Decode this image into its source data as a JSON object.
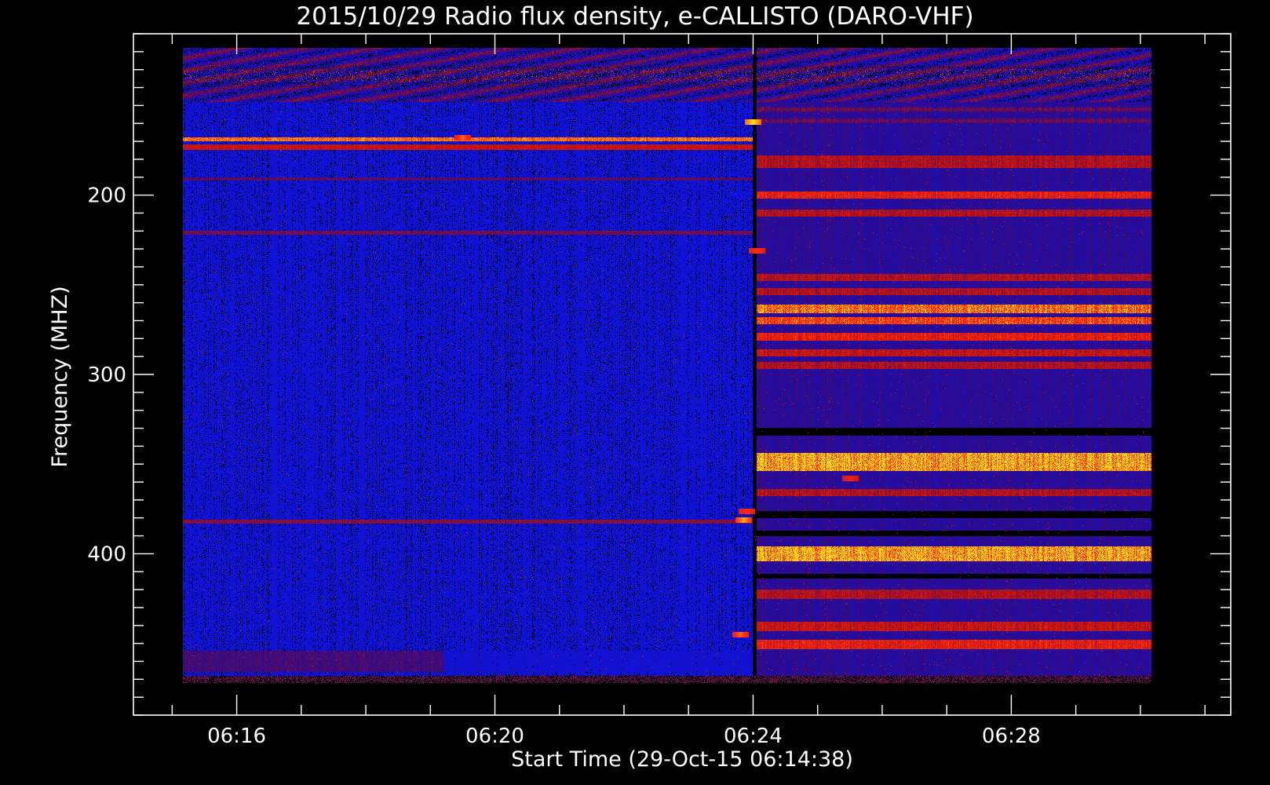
{
  "chart_data": {
    "type": "heatmap",
    "title": "2015/10/29  Radio flux density, e-CALLISTO (DARO-VHF)",
    "xlabel": "Start Time (29-Oct-15 06:14:38)",
    "ylabel": "Frequency (MHZ)",
    "x_axis": {
      "unit": "minutes after 06:00 UT",
      "range": [
        14.4,
        31.4
      ],
      "data_range": [
        15.17,
        30.17
      ],
      "major_ticks": [
        16,
        20,
        24,
        28
      ],
      "tick_labels": [
        "06:16",
        "06:20",
        "06:24",
        "06:28"
      ],
      "minor_step": 1
    },
    "y_axis": {
      "unit": "MHz",
      "range": [
        110,
        490
      ],
      "data_range": [
        118,
        472
      ],
      "inverted": true,
      "major_ticks": [
        200,
        300,
        400
      ],
      "tick_labels": [
        "200",
        "300",
        "400"
      ],
      "minor_step": 10
    },
    "colormap": {
      "background_low": "#0a14e8",
      "background_high": "#2a0a8a",
      "mid": "#b01018",
      "high": "#ff2a10",
      "peak": "#ffe020",
      "dropout": "#000000"
    },
    "step_time": 24.03,
    "regions": {
      "before_step": "uniform blue background",
      "after_step": "horizontal red/purple interference bands"
    },
    "bands_before_step": [
      {
        "f_start": 128,
        "f_end": 138,
        "level": 0.55
      },
      {
        "f_start": 168,
        "f_end": 170,
        "level": 0.9
      },
      {
        "f_start": 172,
        "f_end": 175,
        "level": 0.65
      },
      {
        "f_start": 190,
        "f_end": 192,
        "level": 0.4
      },
      {
        "f_start": 220,
        "f_end": 222,
        "level": 0.45
      },
      {
        "f_start": 381,
        "f_end": 383,
        "level": 0.5
      },
      {
        "f_start": 454,
        "f_end": 466,
        "level": 0.35,
        "t_end": 19.2
      }
    ],
    "bands_after_step": [
      {
        "f_start": 178,
        "f_end": 185,
        "level": 0.6
      },
      {
        "f_start": 198,
        "f_end": 202,
        "level": 0.75
      },
      {
        "f_start": 208,
        "f_end": 212,
        "level": 0.6
      },
      {
        "f_start": 244,
        "f_end": 248,
        "level": 0.6
      },
      {
        "f_start": 252,
        "f_end": 256,
        "level": 0.6
      },
      {
        "f_start": 261,
        "f_end": 266,
        "level": 0.9
      },
      {
        "f_start": 268,
        "f_end": 272,
        "level": 0.85
      },
      {
        "f_start": 277,
        "f_end": 281,
        "level": 0.75
      },
      {
        "f_start": 286,
        "f_end": 290,
        "level": 0.65
      },
      {
        "f_start": 293,
        "f_end": 297,
        "level": 0.6
      },
      {
        "f_start": 344,
        "f_end": 354,
        "level": 0.95
      },
      {
        "f_start": 364,
        "f_end": 368,
        "level": 0.6
      },
      {
        "f_start": 396,
        "f_end": 404,
        "level": 0.95
      },
      {
        "f_start": 420,
        "f_end": 425,
        "level": 0.6
      },
      {
        "f_start": 438,
        "f_end": 443,
        "level": 0.65
      },
      {
        "f_start": 448,
        "f_end": 453,
        "level": 0.75
      }
    ],
    "dark_bands_after_step": [
      {
        "f_start": 330,
        "f_end": 334
      },
      {
        "f_start": 376,
        "f_end": 380
      },
      {
        "f_start": 387,
        "f_end": 390
      },
      {
        "f_start": 411,
        "f_end": 414
      }
    ],
    "hot_spots": [
      {
        "t": 24.0,
        "f": 159,
        "level": 1.0
      },
      {
        "t": 23.85,
        "f": 381,
        "level": 0.95
      },
      {
        "t": 23.9,
        "f": 376,
        "level": 0.85
      },
      {
        "t": 24.05,
        "f": 231,
        "level": 0.85
      },
      {
        "t": 23.8,
        "f": 445,
        "level": 0.9
      },
      {
        "t": 19.5,
        "f": 168,
        "level": 0.9
      },
      {
        "t": 25.5,
        "f": 358,
        "level": 0.8
      }
    ]
  }
}
